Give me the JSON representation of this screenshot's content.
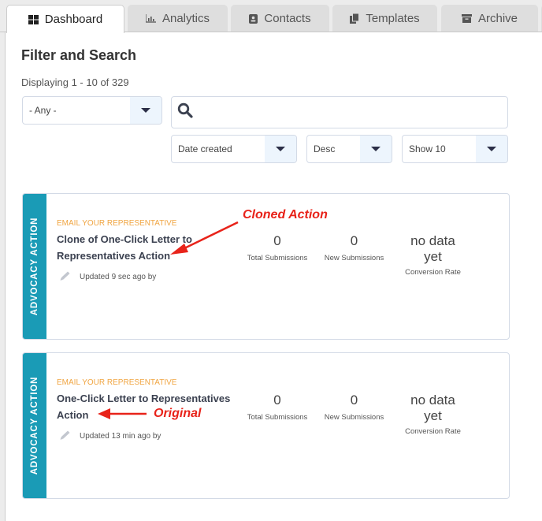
{
  "tabs": [
    {
      "label": "Dashboard",
      "icon": "dashboard-grid-icon",
      "active": true
    },
    {
      "label": "Analytics",
      "icon": "bar-chart-icon",
      "active": false
    },
    {
      "label": "Contacts",
      "icon": "contact-card-icon",
      "active": false
    },
    {
      "label": "Templates",
      "icon": "copy-documents-icon",
      "active": false
    },
    {
      "label": "Archive",
      "icon": "archive-box-icon",
      "active": false
    }
  ],
  "filter": {
    "title": "Filter and Search",
    "displaying": "Displaying 1 - 10 of 329",
    "type_select": "- Any -",
    "search_placeholder": "",
    "sort_field": "Date created",
    "sort_order": "Desc",
    "page_size": "Show 10"
  },
  "cards": [
    {
      "category": "ADVOCACY ACTION",
      "kind": "EMAIL YOUR REPRESENTATIVE",
      "name": "Clone of One-Click Letter to Representatives Action",
      "updated": "Updated 9 sec ago by",
      "total_submissions": "0",
      "total_label": "Total Submissions",
      "new_submissions": "0",
      "new_label": "New Submissions",
      "conversion_line1": "no data",
      "conversion_line2": "yet",
      "conversion_label": "Conversion Rate",
      "annotation": "Cloned Action"
    },
    {
      "category": "ADVOCACY ACTION",
      "kind": "EMAIL YOUR REPRESENTATIVE",
      "name": "One-Click Letter to Representatives Action",
      "updated": "Updated 13 min ago by",
      "total_submissions": "0",
      "total_label": "Total Submissions",
      "new_submissions": "0",
      "new_label": "New Submissions",
      "conversion_line1": "no data",
      "conversion_line2": "yet",
      "conversion_label": "Conversion Rate",
      "annotation": "Original"
    }
  ],
  "colors": {
    "category_strip": "#1a9bb6",
    "kind_text": "#f0a542",
    "annotation": "#e8231a"
  }
}
